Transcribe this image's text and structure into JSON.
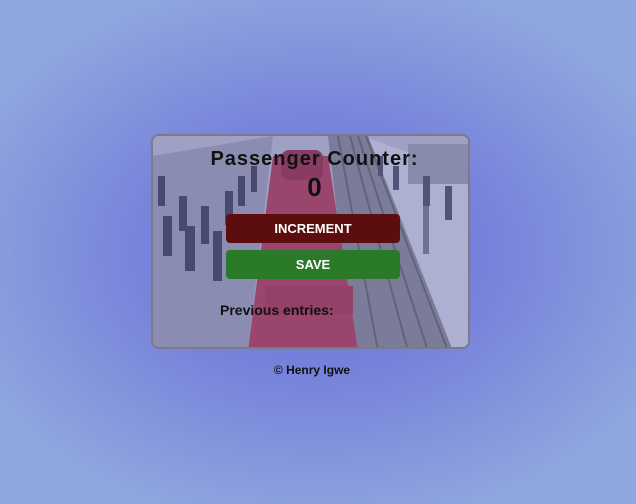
{
  "counter": {
    "heading": "Passenger Counter:",
    "count": "0",
    "increment_label": "INCREMENT",
    "save_label": "SAVE",
    "previous_label": "Previous entries:"
  },
  "footer": {
    "credit": "© Henry Igwe"
  },
  "colors": {
    "increment_button": "#5c0e0e",
    "save_button": "#2a7a2a",
    "background": "#7782da"
  }
}
